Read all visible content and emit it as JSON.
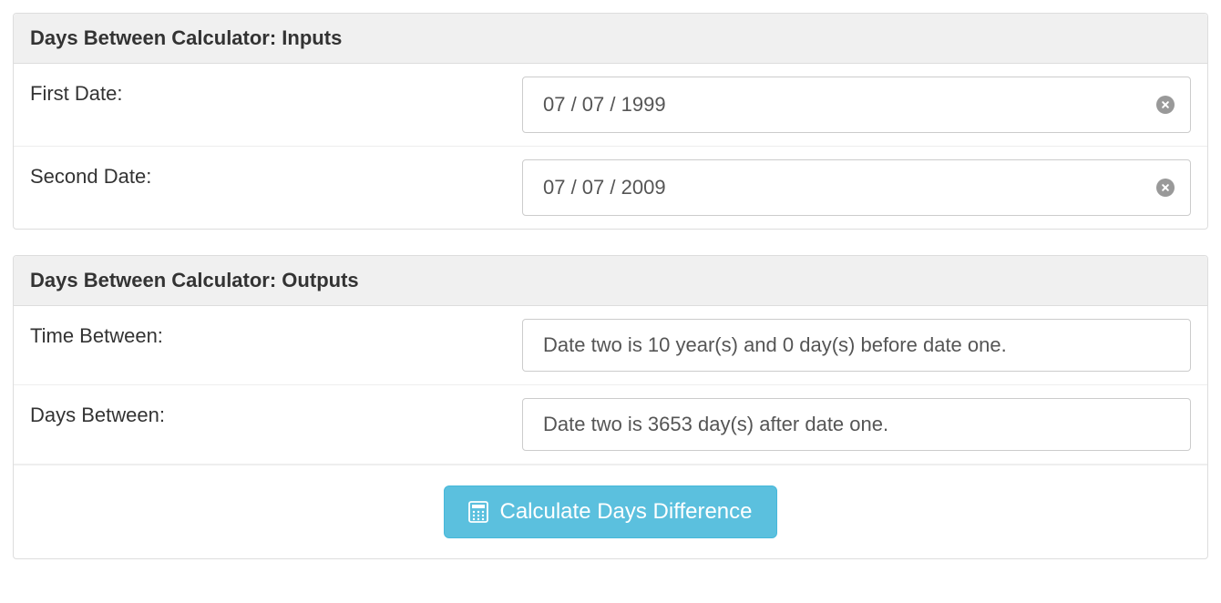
{
  "inputs": {
    "header": "Days Between Calculator: Inputs",
    "first_date": {
      "label": "First Date:",
      "value": "07 / 07 / 1999"
    },
    "second_date": {
      "label": "Second Date:",
      "value": "07 / 07 / 2009"
    }
  },
  "outputs": {
    "header": "Days Between Calculator: Outputs",
    "time_between": {
      "label": "Time Between:",
      "value": "Date two is 10 year(s) and 0 day(s) before date one."
    },
    "days_between": {
      "label": "Days Between:",
      "value": "Date two is 3653 day(s) after date one."
    },
    "button_label": "Calculate Days Difference"
  }
}
